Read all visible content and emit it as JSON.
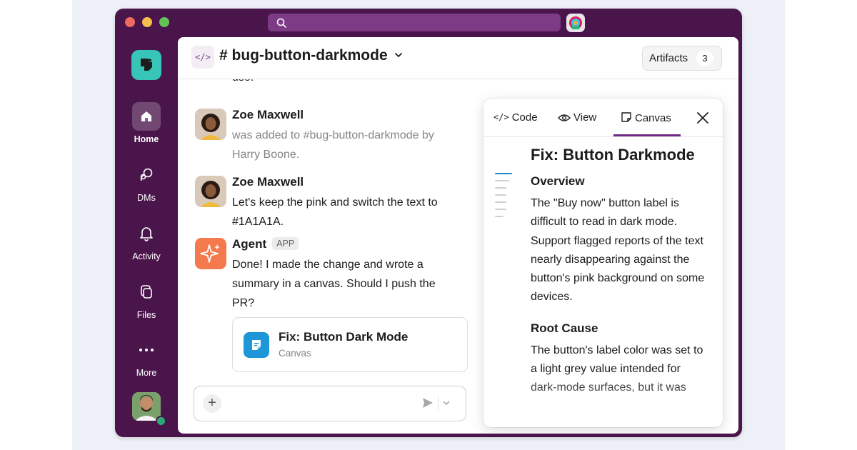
{
  "app": {
    "channel_name": "# bug-button-darkmode",
    "artifacts_label": "Artifacts",
    "artifacts_count": "3",
    "colors": {
      "sidebar": "#4a154b",
      "accent": "#6e2c88",
      "canvas_icon": "#1e97d8",
      "agent_avatar": "#f47a4e"
    }
  },
  "sidebar": {
    "items": [
      {
        "label": "Home",
        "icon": "home-icon",
        "active": true
      },
      {
        "label": "DMs",
        "icon": "dms-icon",
        "active": false
      },
      {
        "label": "Activity",
        "icon": "bell-icon",
        "active": false
      },
      {
        "label": "Files",
        "icon": "files-icon",
        "active": false
      },
      {
        "label": "More",
        "icon": "more-icon",
        "active": false
      }
    ]
  },
  "messages": {
    "partial_text": "use.",
    "m1": {
      "author": "Zoe Maxwell",
      "text": "was added to #bug-button-darkmode by Harry Boone."
    },
    "m2": {
      "author": "Zoe Maxwell",
      "text": "Let's keep the pink and switch the text to #1A1A1A."
    },
    "m3": {
      "author": "Agent",
      "tag": "APP",
      "text": "Done! I made the change and wrote a summary in a canvas. Should I push the PR?"
    },
    "canvas_card": {
      "title": "Fix: Button Dark Mode",
      "subtitle": "Canvas"
    }
  },
  "panel": {
    "tabs": [
      {
        "label": "Code",
        "icon": "code-icon"
      },
      {
        "label": "View",
        "icon": "eye-icon"
      },
      {
        "label": "Canvas",
        "icon": "canvas-icon",
        "active": true
      }
    ],
    "title": "Fix: Button Darkmode",
    "sections": [
      {
        "heading": "Overview",
        "body": "The \"Buy now\" button label is difficult to read in dark mode. Support flagged reports of the text nearly disappearing against the button's pink background on some devices."
      },
      {
        "heading": "Root Cause",
        "body": "The button's label color was set to a light grey value intended for dark-mode surfaces, but it was"
      }
    ]
  }
}
